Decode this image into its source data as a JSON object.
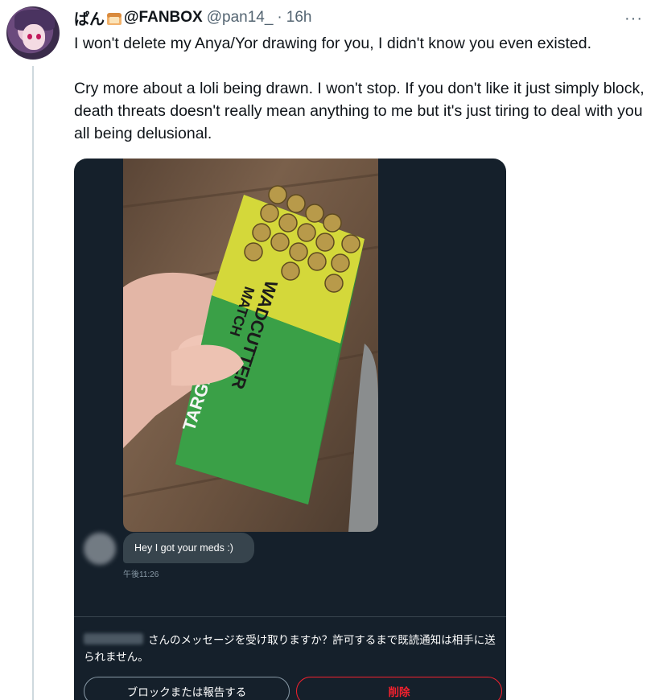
{
  "tweet": {
    "display_name": "ぱん",
    "display_name_suffix": "@FANBOX",
    "handle": "@pan14_",
    "separator": "·",
    "time": "16h",
    "more_label": "···",
    "paragraphs": [
      "I won't delete my Anya/Yor drawing for you, I didn't know you even existed.",
      "Cry more about a loli being drawn. I won't stop. If you don't like it just simply block, death threats doesn't really mean anything to me but it's just tiring to deal with you all being delusional."
    ]
  },
  "media": {
    "photo_texts": [
      "WADCUTTER",
      "MATCH",
      "TARGET"
    ],
    "message": "Hey I got your meds :)",
    "message_time": "午後11:26",
    "request_text": "さんのメッセージを受け取りますか？許可するまで既読通知は相手に送られません。",
    "block_button": "ブロックまたは報告する",
    "delete_button": "削除"
  },
  "colors": {
    "dm_background": "#15202b",
    "bubble": "#37444d",
    "delete_red": "#f4212e",
    "secondary_text": "#536471"
  }
}
